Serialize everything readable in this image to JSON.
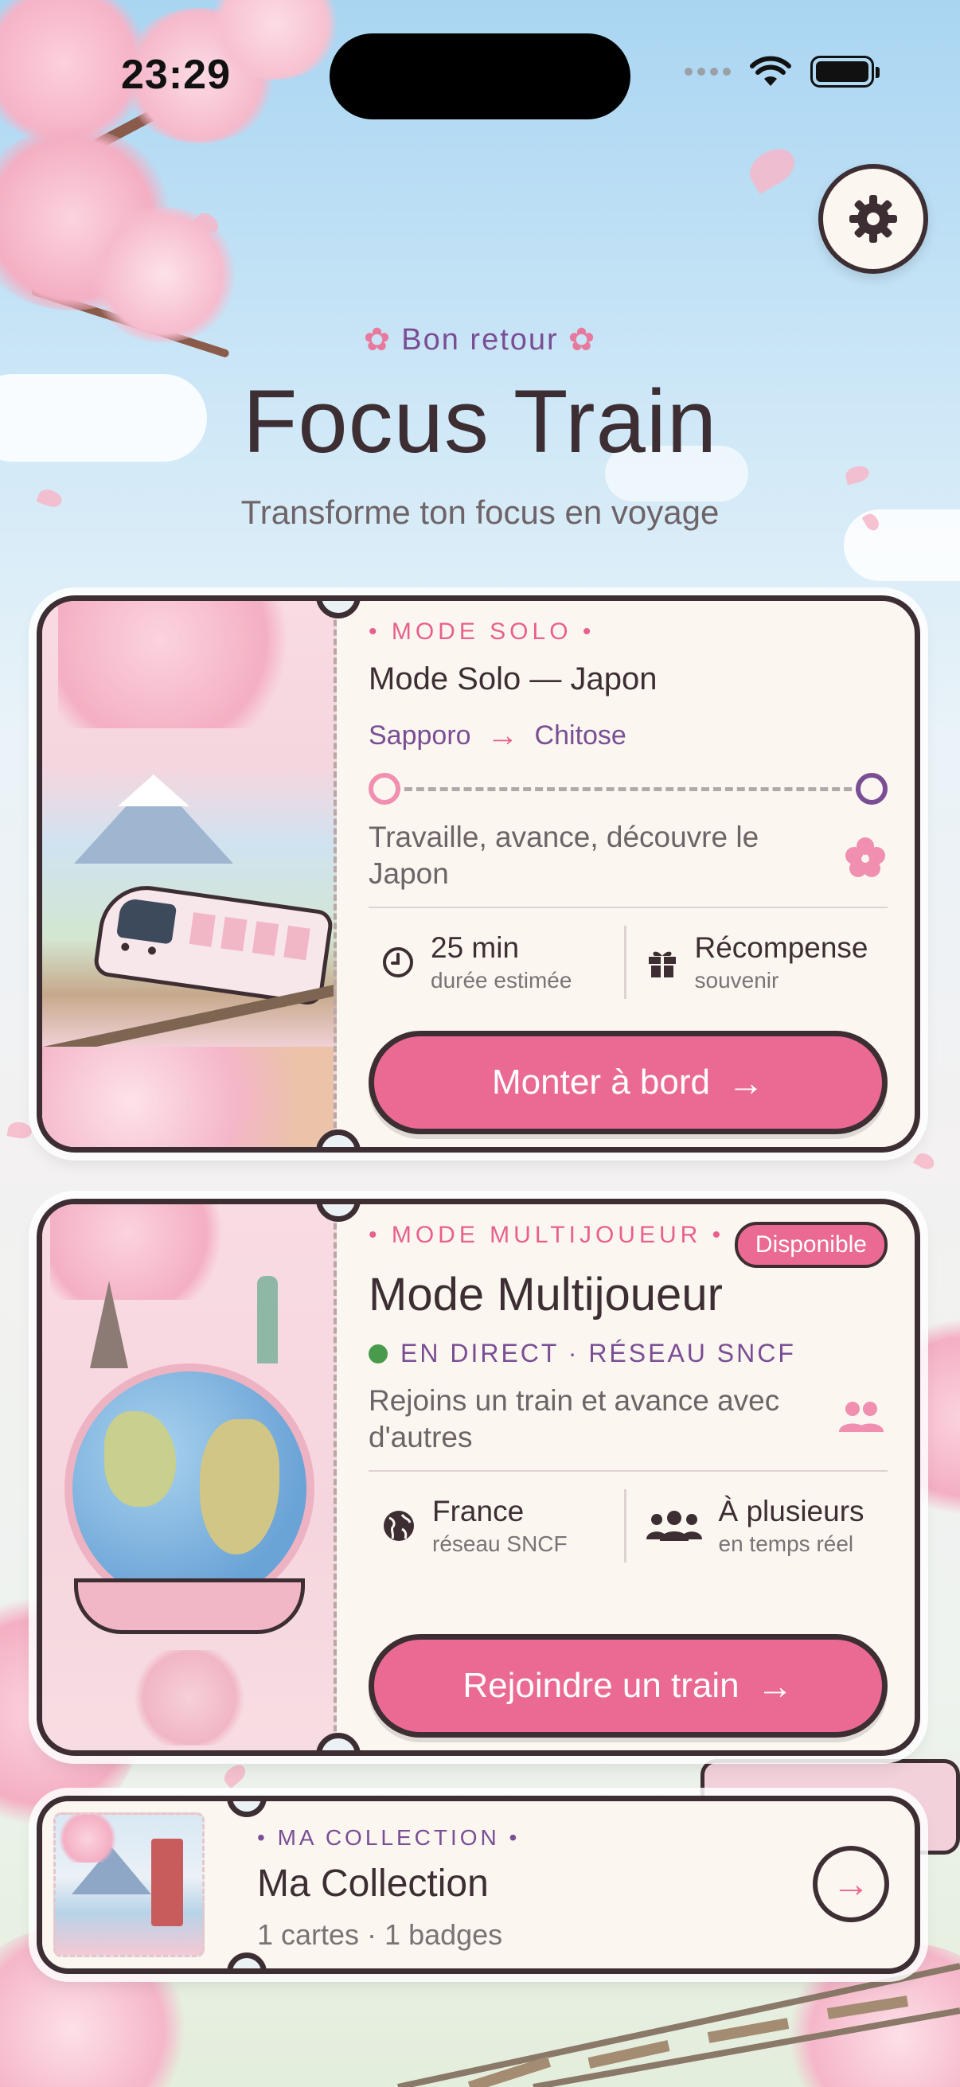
{
  "status_bar": {
    "time": "23:29"
  },
  "header": {
    "welcome": "Bon retour",
    "title": "Focus Train",
    "subtitle": "Transforme ton focus en voyage"
  },
  "solo_card": {
    "label": "• MODE SOLO •",
    "title": "Mode Solo — Japon",
    "route_from": "Sapporo",
    "route_to": "Chitose",
    "description": "Travaille, avance, découvre le Japon",
    "stat1_main": "25 min",
    "stat1_sub": "durée estimée",
    "stat2_main": "Récompense",
    "stat2_sub": "souvenir",
    "button": "Monter à bord"
  },
  "multi_card": {
    "label": "• MODE MULTIJOUEUR •",
    "badge": "Disponible",
    "title": "Mode Multijoueur",
    "live": "EN DIRECT · RÉSEAU SNCF",
    "description": "Rejoins un train et avance avec d'autres",
    "stat1_main": "France",
    "stat1_sub": "réseau SNCF",
    "stat2_main": "À plusieurs",
    "stat2_sub": "en temps réel",
    "button": "Rejoindre un train"
  },
  "collection": {
    "label": "• MA COLLECTION •",
    "title": "Ma Collection",
    "subtitle": "1 cartes · 1 badges"
  },
  "colors": {
    "accent": "#ea6a93",
    "purple": "#7a4e94",
    "ink": "#3d2e33",
    "card_bg": "#fbf7f0",
    "live": "#4a9a4c"
  },
  "icons": [
    "gear-icon",
    "flower-icon",
    "arrow-right-icon",
    "clock-icon",
    "gift-icon",
    "globe-icon",
    "group-icon",
    "users-icon"
  ]
}
